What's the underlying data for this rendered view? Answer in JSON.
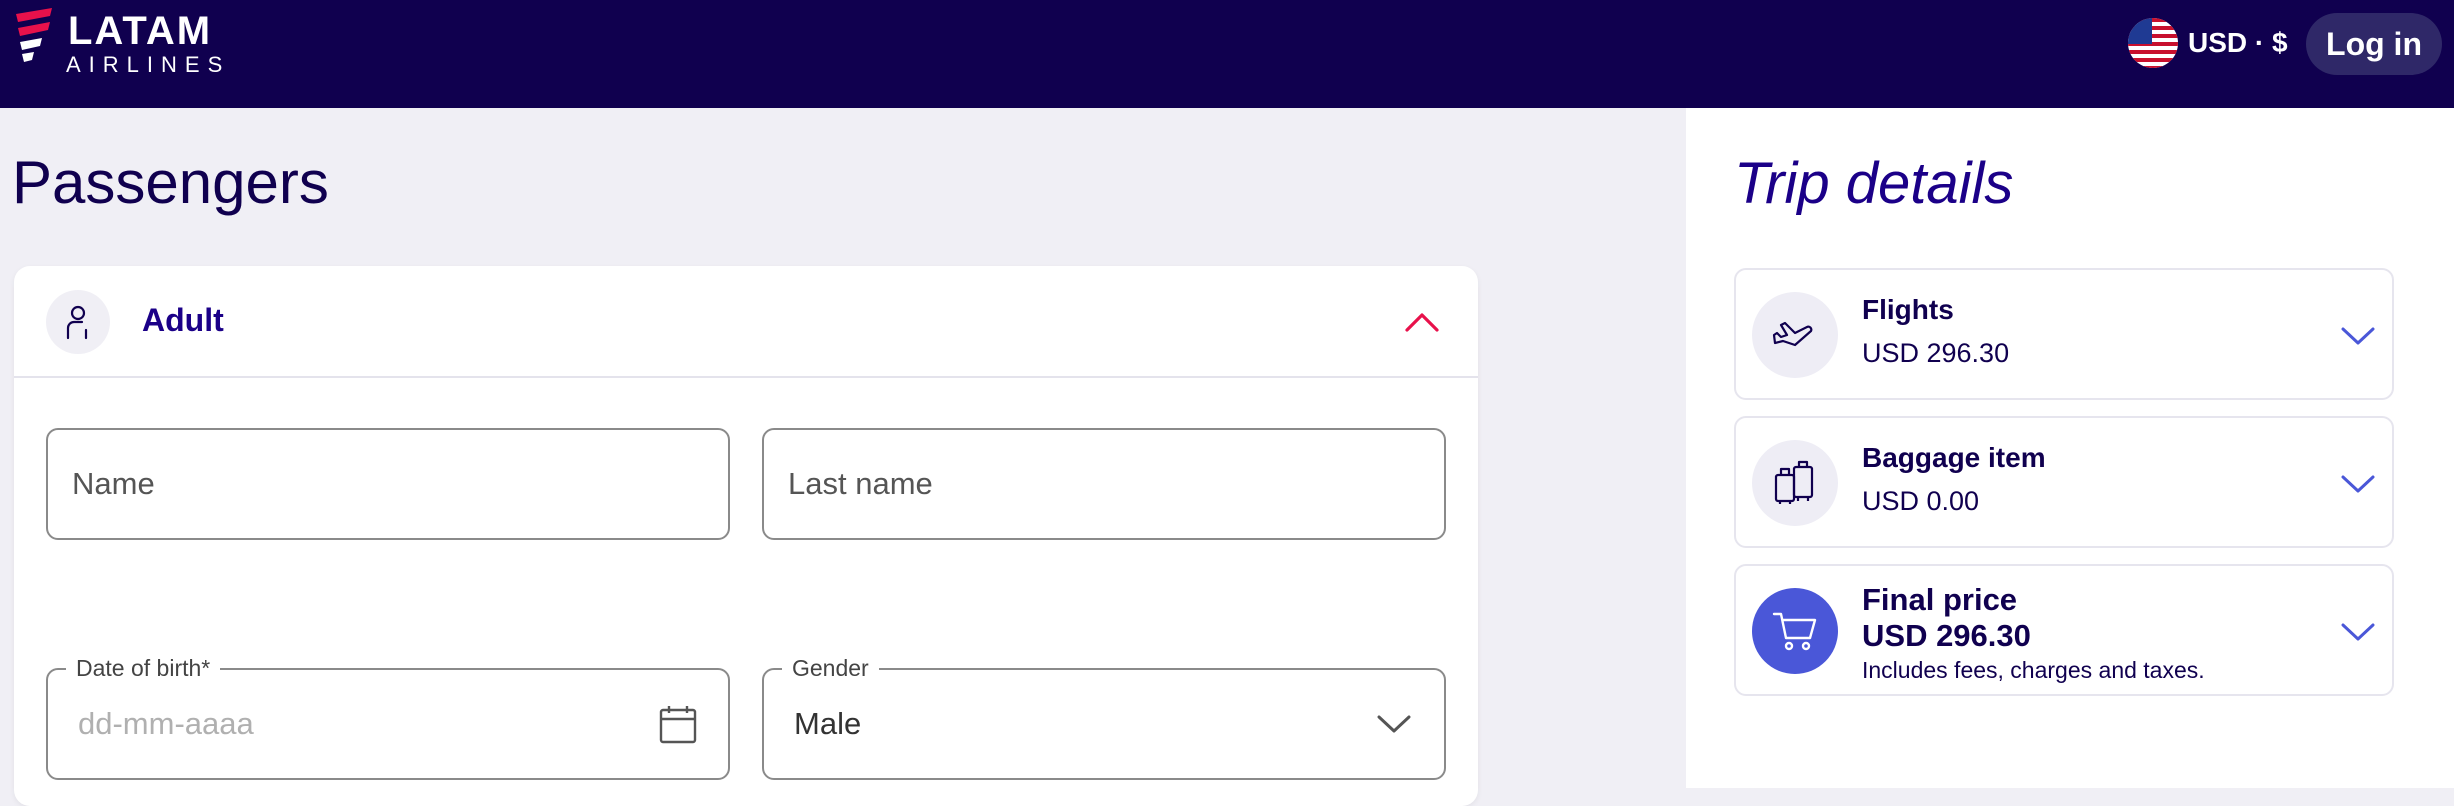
{
  "header": {
    "brand_word": "LATAM",
    "brand_sub": "AIRLINES",
    "currency_label": "USD · $",
    "login_label": "Log in"
  },
  "main": {
    "title": "Passengers",
    "passenger_card": {
      "title": "Adult",
      "name_placeholder": "Name",
      "last_name_placeholder": "Last name",
      "dob_label": "Date of birth*",
      "dob_placeholder": "dd-mm-aaaa",
      "gender_label": "Gender",
      "gender_value": "Male"
    }
  },
  "trip_details": {
    "title": "Trip details",
    "items": [
      {
        "title": "Flights",
        "amount": "USD 296.30",
        "icon": "airplane-icon"
      },
      {
        "title": "Baggage item",
        "amount": "USD 0.00",
        "icon": "luggage-icon"
      }
    ],
    "final": {
      "title": "Final price",
      "amount": "USD 296.30",
      "note": "Includes fees, charges and taxes.",
      "icon": "cart-icon"
    }
  },
  "colors": {
    "header_bg": "#10004f",
    "brand_text": "#1b0088",
    "accent_red": "#e8114b",
    "accent_blue": "#4a57d8"
  }
}
